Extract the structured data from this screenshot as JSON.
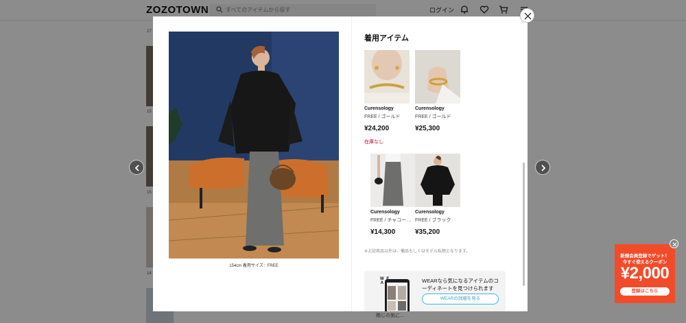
{
  "site": {
    "logo": "ZOZOTOWN",
    "search_placeholder": "すべてのアイテムから探す",
    "login_label": "ログイン"
  },
  "background": {
    "labels": [
      "17",
      "15",
      "15",
      "14"
    ],
    "bottom_text": "賄じの気に..."
  },
  "photo": {
    "caption": "154cm  着用サイズ：FREE"
  },
  "panel": {
    "title": "着用アイテム",
    "items": [
      {
        "brand": "Curensology",
        "variant": "FREE / ゴールド",
        "price": "¥24,200",
        "stock": "在庫なし"
      },
      {
        "brand": "Curensology",
        "variant": "FREE / ゴールド",
        "price": "¥25,300"
      },
      {
        "brand": "Curensology",
        "variant": "FREE / チャコールグレー",
        "price": "¥14,300"
      },
      {
        "brand": "Curensology",
        "variant": "FREE / ブラック",
        "price": "¥35,200"
      }
    ],
    "note": "※上記商品以外は、備品もしくはモデル私物となります。"
  },
  "wear": {
    "logo_lines": [
      "W E",
      "A R"
    ],
    "description": "WEARなら気になるアイテムのコーディネートを見つけられます",
    "button_label": "WEARの詳細を見る"
  },
  "coupon": {
    "line1": "新規会員登録でゲット！",
    "line2": "今すぐ使えるクーポン",
    "amount": "¥2,000",
    "button_label": "登録はこちら"
  },
  "colors": {
    "accent_red": "#d0021b",
    "coupon_orange": "#f24b2a",
    "wear_blue": "#3eb5e0"
  }
}
